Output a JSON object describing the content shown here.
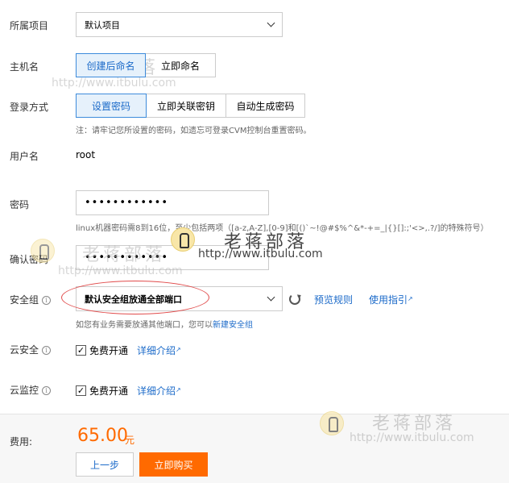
{
  "project": {
    "label": "所属项目",
    "selected": "默认项目"
  },
  "hostname": {
    "label": "主机名",
    "options": [
      "创建后命名",
      "立即命名"
    ],
    "active_index": 0
  },
  "login": {
    "label": "登录方式",
    "options": [
      "设置密码",
      "立即关联密钥",
      "自动生成密码"
    ],
    "active_index": 0,
    "note": "注：请牢记您所设置的密码，如遗忘可登录CVM控制台重置密码。"
  },
  "username": {
    "label": "用户名",
    "value": "root"
  },
  "password": {
    "label": "密码",
    "masked_value": "••••••••••••",
    "hint": "linux机器密码需8到16位，至少包括两项（[a-z,A-Z],[0-9]和[()`~!@#$%^&*-+=_|{}[]:;'<>,.?/]的特殊符号）"
  },
  "confirm_password": {
    "label": "确认密码",
    "masked_value": "••••••••••••"
  },
  "security_group": {
    "label": "安全组",
    "selected": "默认安全组放通全部端口",
    "preview_rules": "预览规则",
    "usage_guide": "使用指引",
    "note_prefix": "如您有业务需要放通其他端口，您可以",
    "note_link": "新建安全组"
  },
  "cloud_security": {
    "label": "云安全",
    "checkbox_label": "免费开通",
    "checked": true,
    "detail_link": "详细介绍"
  },
  "cloud_monitor": {
    "label": "云监控",
    "checkbox_label": "免费开通",
    "checked": true,
    "detail_link": "详细介绍"
  },
  "footer": {
    "fee_label": "费用:",
    "price": "65.00",
    "unit": "元",
    "prev_button": "上一步",
    "buy_button": "立即购买"
  },
  "watermark": {
    "name": "老蒋部落",
    "url": "http://www.itbulu.com"
  },
  "icons": {
    "select_chevron": "chevron-down-icon",
    "info": "info-icon",
    "refresh": "refresh-icon",
    "external_link": "external-link-icon",
    "checkmark": "check-icon"
  },
  "colors": {
    "accent": "#1b6ac9",
    "price": "#ff6a00",
    "annotation": "#e14b4b"
  }
}
